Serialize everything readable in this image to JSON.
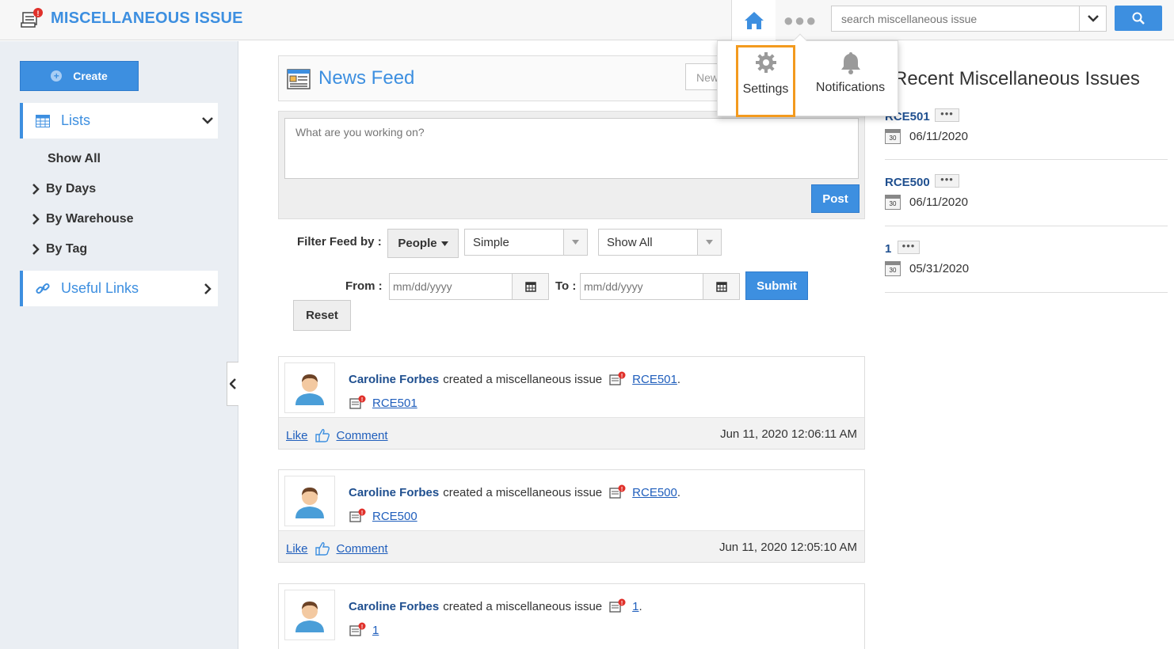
{
  "header": {
    "app_title": "MISCELLANEOUS ISSUE",
    "search_placeholder": "search miscellaneous issue",
    "accent_color": "#3d8fe0"
  },
  "popup": {
    "settings_label": "Settings",
    "notifications_label": "Notifications",
    "highlight_color": "#f39a1e"
  },
  "sidebar": {
    "create_label": "Create",
    "lists_label": "Lists",
    "show_all": "Show All",
    "by_days": "By Days",
    "by_warehouse": "By Warehouse",
    "by_tag": "By Tag",
    "useful_links_label": "Useful Links"
  },
  "feed": {
    "title": "News Feed",
    "new_button": "New",
    "compose_placeholder": "What are you working on?",
    "post_label": "Post",
    "filter_label": "Filter Feed by :",
    "people_label": "People",
    "type_value": "Simple",
    "show_value": "Show All",
    "from_label": "From :",
    "to_label": "To :",
    "date_placeholder": "mm/dd/yyyy",
    "submit_label": "Submit",
    "reset_label": "Reset",
    "like_label": "Like",
    "comment_label": "Comment",
    "posts": [
      {
        "author": "Caroline Forbes",
        "action": "created a miscellaneous issue",
        "ref": "RCE501",
        "timestamp": "Jun 11, 2020 12:06:11 AM"
      },
      {
        "author": "Caroline Forbes",
        "action": "created a miscellaneous issue",
        "ref": "RCE500",
        "timestamp": "Jun 11, 2020 12:05:10 AM"
      },
      {
        "author": "Caroline Forbes",
        "action": "created a miscellaneous issue",
        "ref": "1",
        "timestamp": ""
      }
    ]
  },
  "recent": {
    "title": "Recent Miscellaneous Issues",
    "items": [
      {
        "id": "RCE501",
        "date": "06/11/2020"
      },
      {
        "id": "RCE500",
        "date": "06/11/2020"
      },
      {
        "id": "1",
        "date": "05/31/2020"
      }
    ],
    "calendar_day": "30"
  }
}
